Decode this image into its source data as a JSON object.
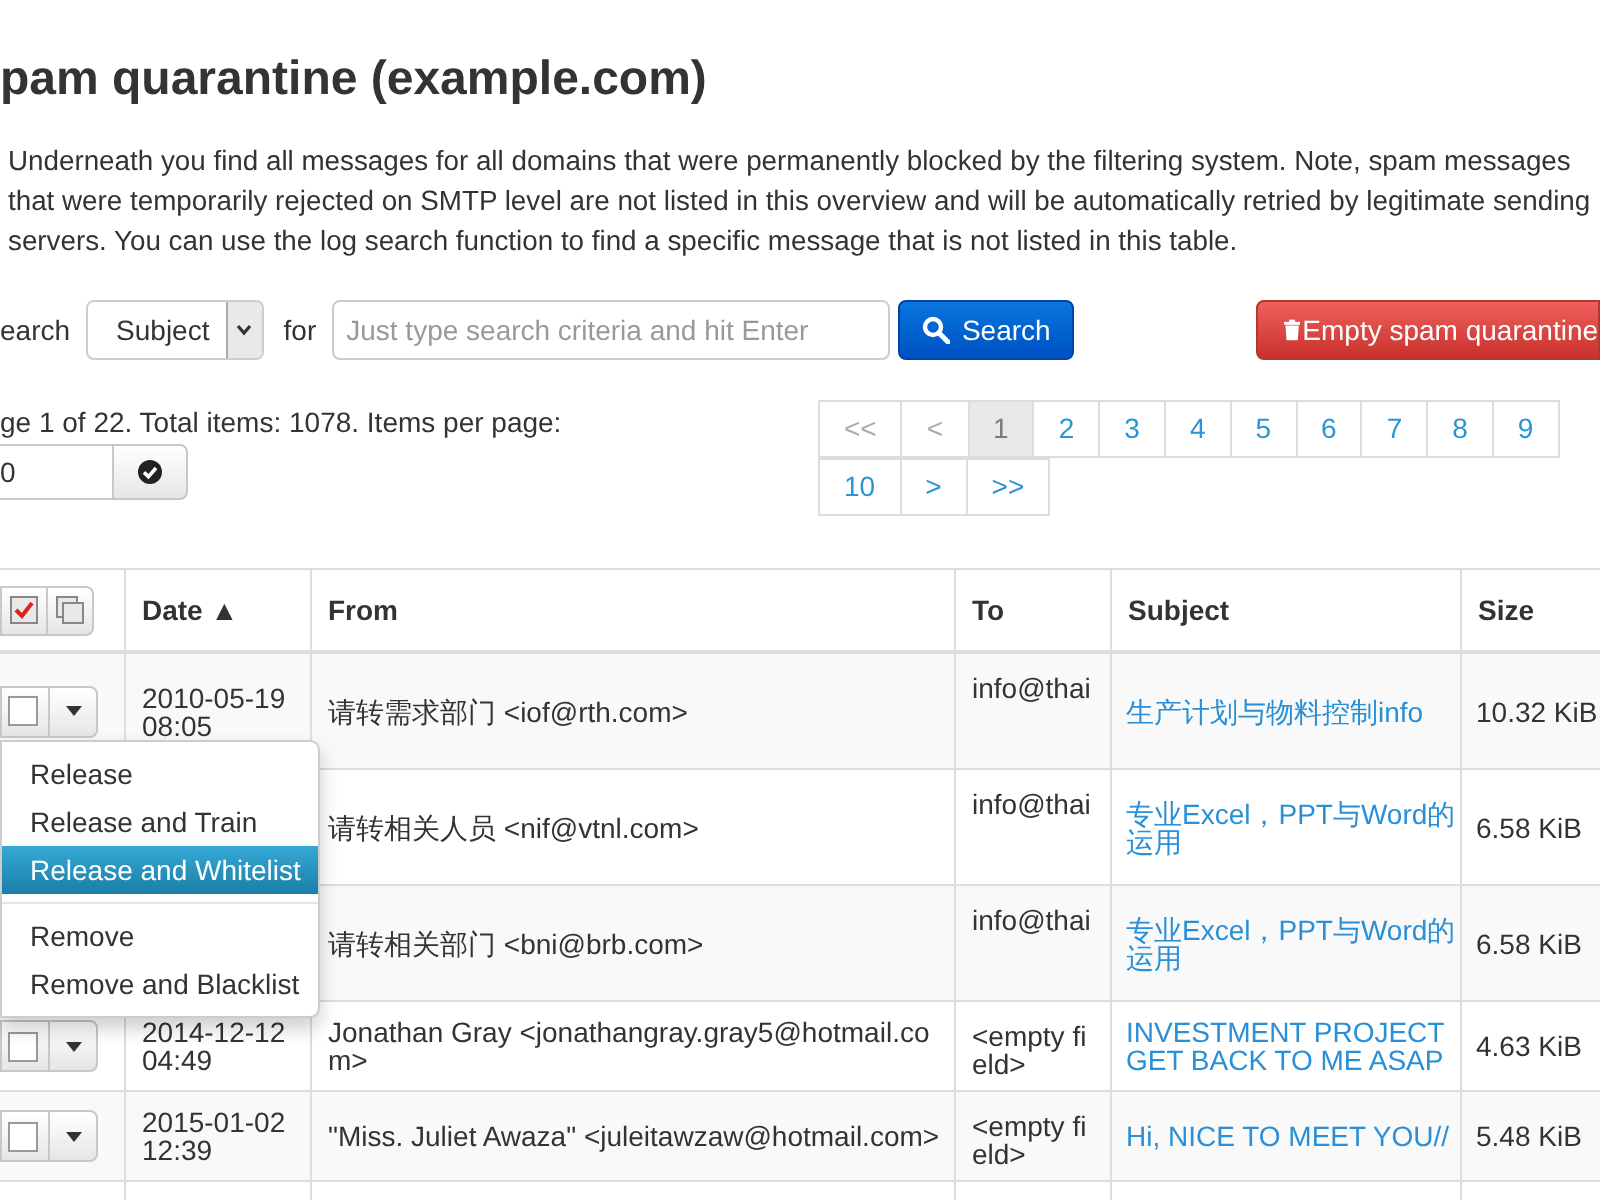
{
  "page": {
    "title": "pam quarantine (example.com)",
    "description": "Underneath you find all messages for all domains that were permanently blocked by the filtering system. Note, spam messages that were temporarily rejected on SMTP level are not listed in this overview and will be automatically retried by legitimate sending servers. You can use the log search function to find a specific message that is not listed in this table."
  },
  "search": {
    "label": "earch",
    "field": "Subject",
    "for_label": "for",
    "placeholder": "Just type search criteria and hit Enter",
    "button": "Search"
  },
  "empty_button": "Empty spam quarantine",
  "paging": {
    "summary": "ge 1 of 22. Total items: 1078. Items per page:",
    "per_page": "0",
    "pages": [
      {
        "label": "<<",
        "selected": false,
        "disabled": true
      },
      {
        "label": "<",
        "selected": false,
        "disabled": true
      },
      {
        "label": "1",
        "selected": true,
        "disabled": false
      },
      {
        "label": "2",
        "selected": false,
        "disabled": false
      },
      {
        "label": "3",
        "selected": false,
        "disabled": false
      },
      {
        "label": "4",
        "selected": false,
        "disabled": false
      },
      {
        "label": "5",
        "selected": false,
        "disabled": false
      },
      {
        "label": "6",
        "selected": false,
        "disabled": false
      },
      {
        "label": "7",
        "selected": false,
        "disabled": false
      },
      {
        "label": "8",
        "selected": false,
        "disabled": false
      },
      {
        "label": "9",
        "selected": false,
        "disabled": false
      },
      {
        "label": "10",
        "selected": false,
        "disabled": false
      },
      {
        "label": ">",
        "selected": false,
        "disabled": false
      },
      {
        "label": ">>",
        "selected": false,
        "disabled": false
      }
    ]
  },
  "table": {
    "columns": [
      {
        "label": "Date ▲"
      },
      {
        "label": "From"
      },
      {
        "label": "To"
      },
      {
        "label": "Subject"
      },
      {
        "label": "Size"
      }
    ],
    "rows": [
      {
        "checked": false,
        "date": "2010-05-19 08:05",
        "from": "请转需求部门 <iof@rth.com>",
        "to": "info@thai",
        "subject": "生产计划与物料控制info",
        "size": "10.32 KiB"
      },
      {
        "from": "请转相关人员 <nif@vtnl.com>",
        "to": "info@thai",
        "subject": "专业Excel，PPT与Word的运用",
        "size": "6.58 KiB"
      },
      {
        "from": "请转相关部门 <bni@brb.com>",
        "to": "info@thai",
        "subject": "专业Excel，PPT与Word的运用",
        "size": "6.58 KiB"
      },
      {
        "checked": false,
        "date": "2014-12-12 04:49",
        "from": "Jonathan Gray <jonathangray.gray5@hotmail.com>",
        "to": "<empty field>",
        "subject": "INVESTMENT PROJECT GET BACK TO ME ASAP",
        "size": "4.63 KiB"
      },
      {
        "checked": false,
        "date": "2015-01-02 12:39",
        "from": "\"Miss. Juliet Awaza\" <juleitawzaw@hotmail.com>",
        "to": "<empty field>",
        "subject": "Hi, NICE TO MEET YOU//",
        "size": "5.48 KiB"
      }
    ]
  },
  "row_menu": {
    "groups": [
      {
        "items": [
          {
            "label": "Release",
            "selected": false
          },
          {
            "label": "Release and Train",
            "selected": false
          },
          {
            "label": "Release and Whitelist",
            "selected": true
          }
        ]
      },
      {
        "items": [
          {
            "label": "Remove",
            "selected": false
          },
          {
            "label": "Remove and Blacklist",
            "selected": false
          }
        ]
      }
    ]
  }
}
